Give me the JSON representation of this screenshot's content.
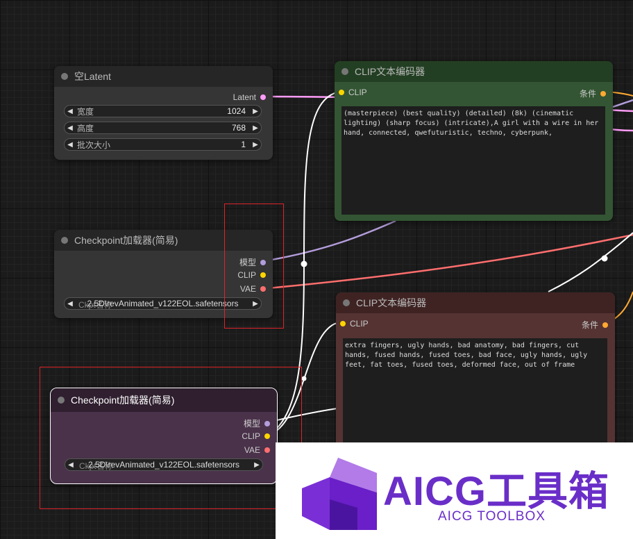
{
  "node_empty_latent": {
    "title": "空Latent",
    "output_latent": "Latent",
    "width_label": "宽度",
    "width_value": "1024",
    "height_label": "高度",
    "height_value": "768",
    "batch_label": "批次大小",
    "batch_value": "1"
  },
  "node_checkpoint_1": {
    "title": "Checkpoint加载器(简易)",
    "output_model": "模型",
    "output_clip": "CLIP",
    "output_vae": "VAE",
    "ckpt_label": "Ckpt名称",
    "ckpt_value": "2.5D\\revAnimated_v122EOL.safetensors"
  },
  "node_checkpoint_2": {
    "title": "Checkpoint加载器(简易)",
    "output_model": "模型",
    "output_clip": "CLIP",
    "output_vae": "VAE",
    "ckpt_label": "Ckpt名称",
    "ckpt_value": "2.5D\\revAnimated_v122EOL.safetensors"
  },
  "node_clip_positive": {
    "title": "CLIP文本编码器",
    "input_clip": "CLIP",
    "output_conditioning": "条件",
    "text": "(masterpiece) (best quality) (detailed) (8k) (cinematic lighting) (sharp focus) (intricate),A girl with a wire in her hand, connected, qwefuturistic, techno, cyberpunk,"
  },
  "node_clip_negative": {
    "title": "CLIP文本编码器",
    "input_clip": "CLIP",
    "output_conditioning": "条件",
    "text": "extra fingers, ugly hands, bad anatomy, bad fingers, cut hands, fused hands, fused toes, bad face, ugly hands, ugly feet, fat toes, fused toes, deformed face, out of frame"
  },
  "watermark": {
    "title": "AICG工具箱",
    "subtitle": "AICG TOOLBOX"
  },
  "colors": {
    "latent": "#ff9cf9",
    "model": "#b39ddb",
    "clip": "#ffd500",
    "vae": "#ff6e6e",
    "conditioning": "#ffa931",
    "selection": "#e0242a",
    "brand": "#6a2ec8"
  },
  "icons": {
    "arrow_left": "left-triangle-icon",
    "arrow_right": "right-triangle-icon",
    "logo": "aicg-cube-logo"
  }
}
